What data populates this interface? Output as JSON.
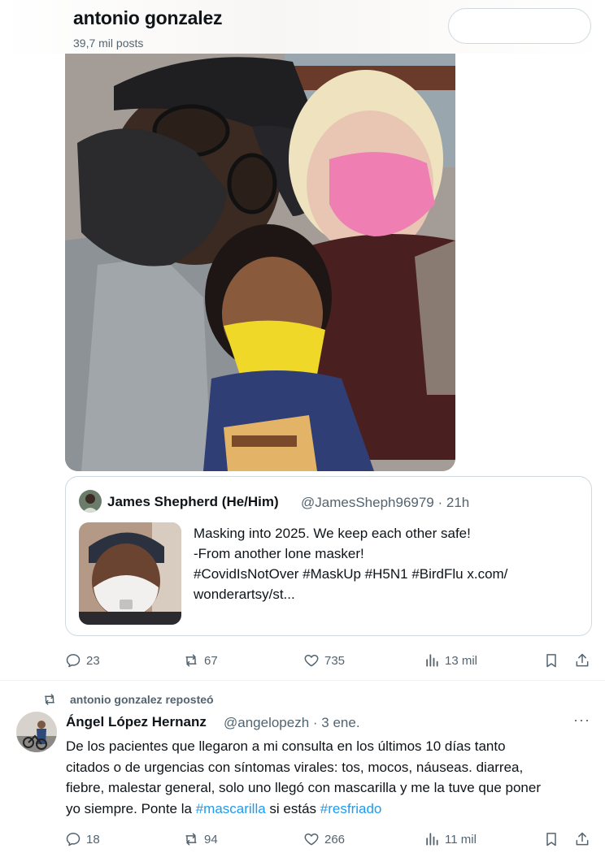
{
  "header": {
    "profile_name": "antonio gonzalez",
    "post_count": "39,7 mil posts"
  },
  "tweet1": {
    "image_alt": "selfie of three people wearing masks",
    "quote": {
      "name": "James Shepherd (He/Him)",
      "handle_time": "@JamesSheph96979 · 21h",
      "lines": [
        "Masking into 2025. We keep each other safe!",
        "-From another lone masker!",
        "#CovidIsNotOver #MaskUp #H5N1 #BirdFlu  x.com/",
        "wonderartsy/st..."
      ]
    },
    "actions": {
      "replies": "23",
      "reposts": "67",
      "likes": "735",
      "views": "13 mil"
    }
  },
  "tweet2": {
    "repost_label": "antonio gonzalez reposteó",
    "name": "Ángel López Hernanz",
    "handle_time": "@angelopezh · 3 ene.",
    "more": "···",
    "lines": [
      "De los pacientes que llegaron a mi consulta en los últimos 10 días tanto",
      "citados o de urgencias con síntomas virales: tos, mocos, náuseas. diarrea,",
      "fiebre, malestar general, solo uno llegó con mascarilla y me la tuve que poner"
    ],
    "last_line": {
      "before": "yo siempre. Ponte la ",
      "tag1": "#mascarilla",
      "middle": " si estás ",
      "tag2": "#resfriado"
    },
    "actions": {
      "replies": "18",
      "reposts": "94",
      "likes": "266",
      "views": "11 mil"
    }
  },
  "colors": {
    "text": "#0f1419",
    "secondary": "#536471",
    "link": "#1d9bf0",
    "border": "#cfd9de"
  }
}
